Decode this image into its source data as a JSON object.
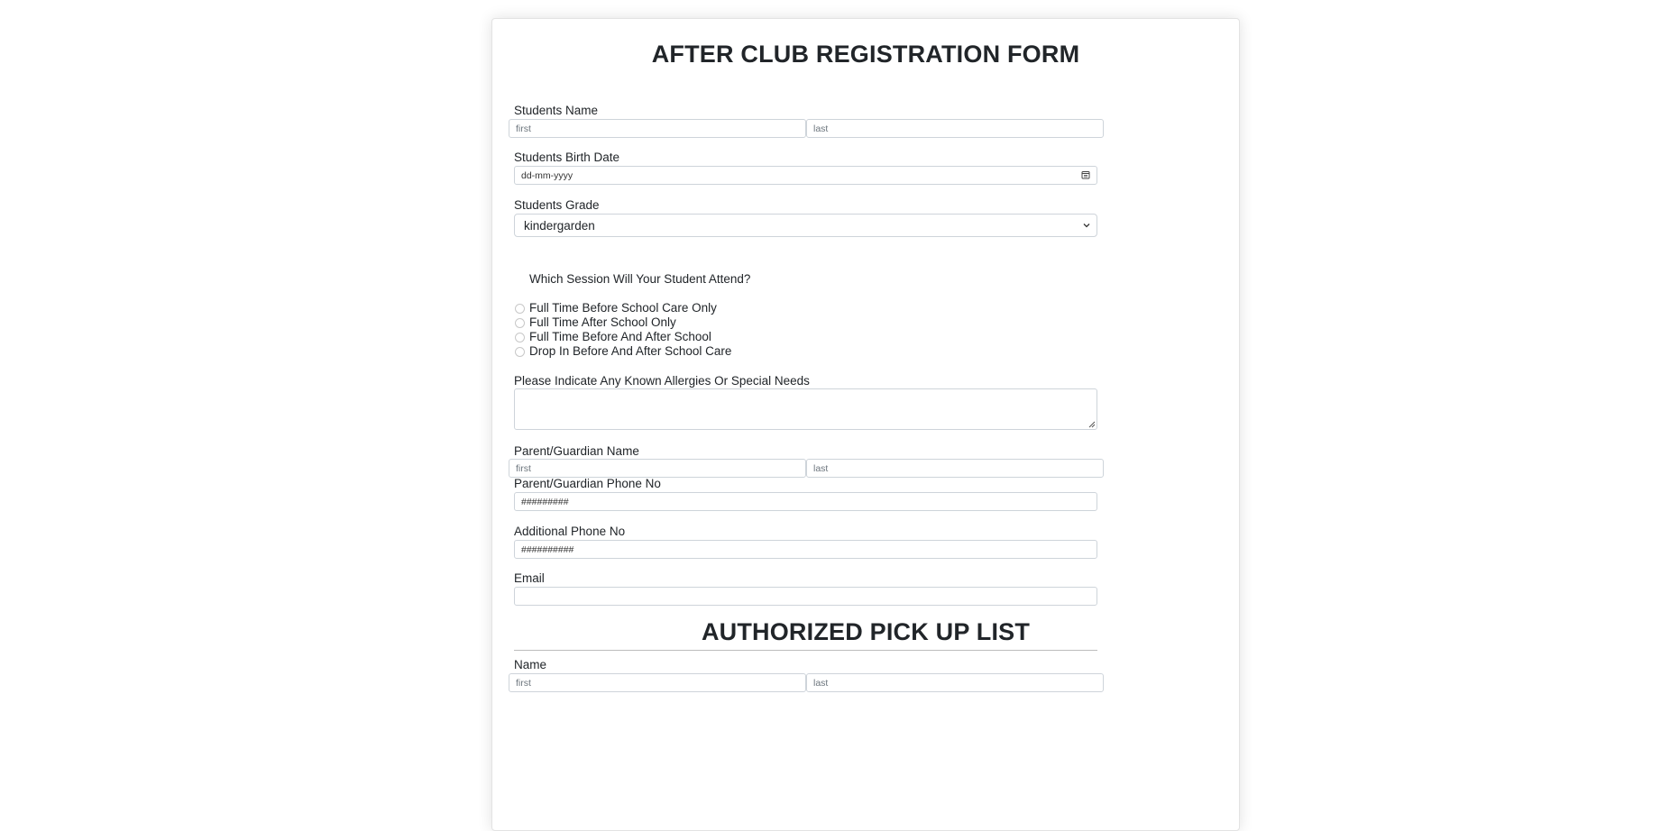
{
  "form": {
    "title": "AFTER CLUB REGISTRATION FORM",
    "student_name": {
      "label": "Students Name",
      "first_placeholder": "first",
      "last_placeholder": "last"
    },
    "birth_date": {
      "label": "Students Birth Date",
      "placeholder": "dd-mm-yyyy"
    },
    "grade": {
      "label": "Students Grade",
      "value": "kindergarden"
    },
    "session": {
      "question": "Which Session Will Your Student Attend?",
      "options": [
        "Full Time Before School Care Only",
        "Full Time After School Only",
        "Full Time Before And After School",
        "Drop In Before And After School Care"
      ]
    },
    "allergies": {
      "label": "Please Indicate Any Known Allergies Or Special Needs"
    },
    "guardian_name": {
      "label": "Parent/Guardian Name",
      "first_placeholder": "first",
      "last_placeholder": "last"
    },
    "guardian_phone": {
      "label": "Parent/Guardian Phone No",
      "placeholder": "#########"
    },
    "additional_phone": {
      "label": "Additional Phone No",
      "placeholder": "##########"
    },
    "email": {
      "label": "Email"
    },
    "pickup": {
      "title": "AUTHORIZED PICK UP LIST",
      "name": {
        "label": "Name",
        "first_placeholder": "first",
        "last_placeholder": "last"
      }
    }
  }
}
